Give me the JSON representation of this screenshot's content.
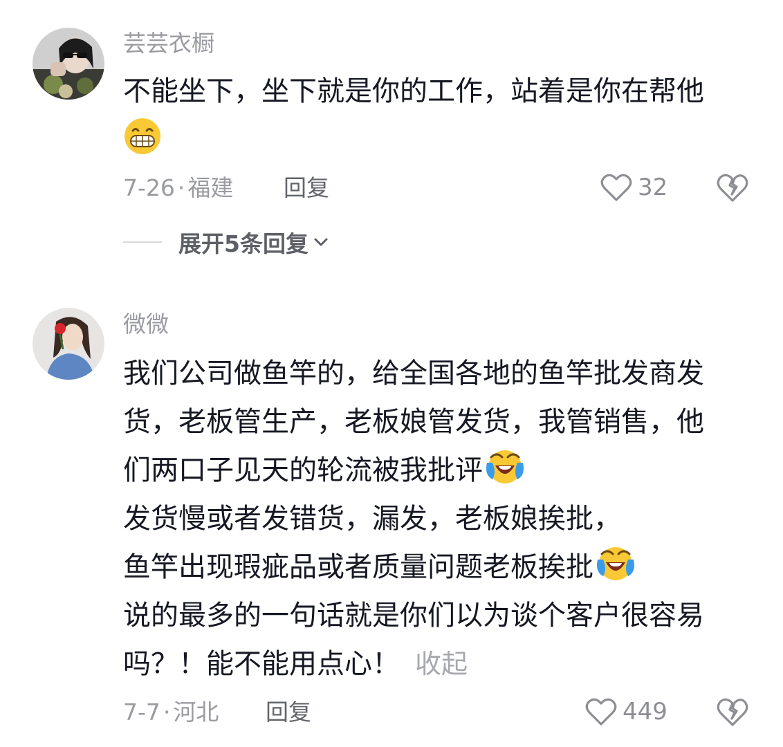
{
  "comments": [
    {
      "username": "芸芸衣橱",
      "lines": [
        "不能坐下，坐下就是你的工作，站着是你在帮他"
      ],
      "date": "7-26",
      "location": "福建",
      "reply_label": "回复",
      "like_count": "32",
      "expand_label": "展开5条回复",
      "emoji": "grinning-face"
    },
    {
      "username": "微微",
      "lines": [
        "我们公司做鱼竿的，给全国各地的鱼竿批发商发",
        "货，老板管生产，老板娘管发货，我管销售，他",
        "们两口子见天的轮流被我批评",
        "发货慢或者发错货，漏发，老板娘挨批，",
        "鱼竿出现瑕疵品或者质量问题老板挨批",
        "说的最多的一句话就是你们以为谈个客户很容易",
        "吗？！能不能用点心！"
      ],
      "collapse_label": "收起",
      "date": "7-7",
      "location": "河北",
      "reply_label": "回复",
      "like_count": "449",
      "emoji": "crying-laughing-face"
    }
  ],
  "icons": {
    "like": "heart-outline-icon",
    "dislike": "broken-heart-icon",
    "chevron": "chevron-down-icon"
  },
  "colors": {
    "text": "#161823",
    "secondary": "#9a9ba1",
    "reply": "#62646b"
  }
}
